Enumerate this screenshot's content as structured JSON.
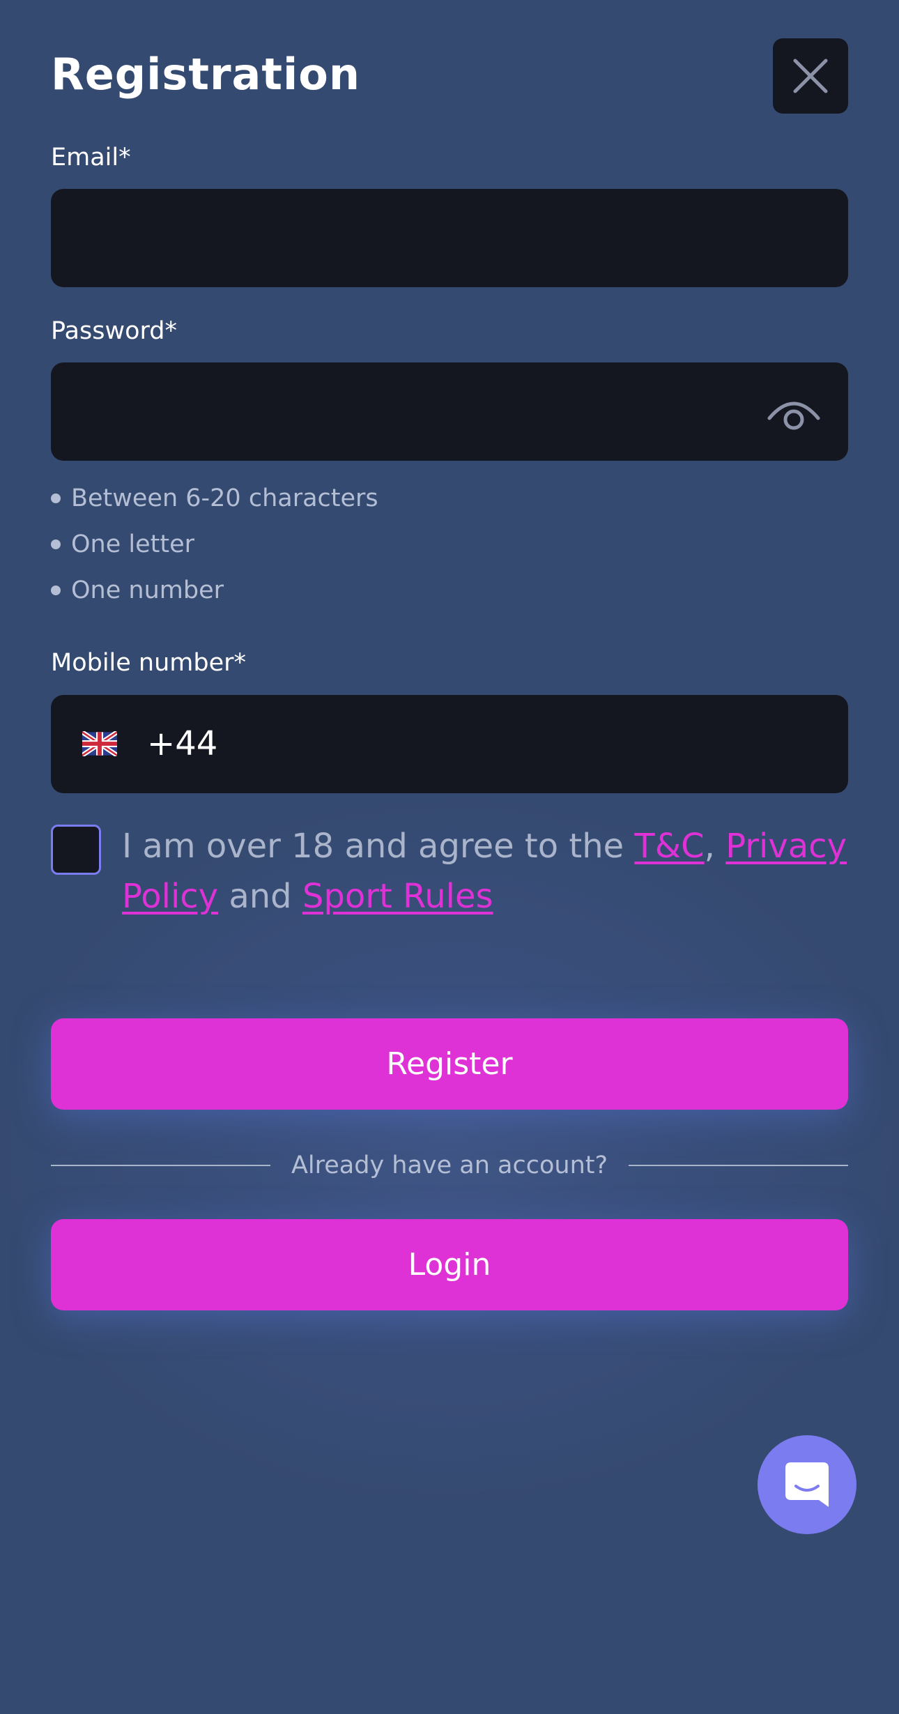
{
  "header": {
    "title": "Registration"
  },
  "email": {
    "label": "Email*",
    "value": "",
    "placeholder": ""
  },
  "password": {
    "label": "Password*",
    "value": "",
    "placeholder": "",
    "rules": [
      "Between 6-20 characters",
      "One letter",
      "One number"
    ]
  },
  "mobile": {
    "label": "Mobile number*",
    "country_code": "+44",
    "flag_icon": "uk-flag-icon",
    "value": ""
  },
  "agreement": {
    "checked": false,
    "prefix": "I am over 18 and agree to the ",
    "link_tc": "T&C",
    "comma": ", ",
    "link_privacy": "Privacy Policy",
    "and": " and ",
    "link_sport": "Sport Rules"
  },
  "actions": {
    "register_label": "Register",
    "divider_text": "Already have an account?",
    "login_label": "Login"
  },
  "icons": {
    "close": "close-icon",
    "eye": "eye-icon",
    "chat": "chat-icon"
  },
  "colors": {
    "background": "#354a70",
    "field": "#151720",
    "accent": "#de31d6",
    "chat": "#7b7cf0",
    "muted_text": "#aab5cc"
  }
}
